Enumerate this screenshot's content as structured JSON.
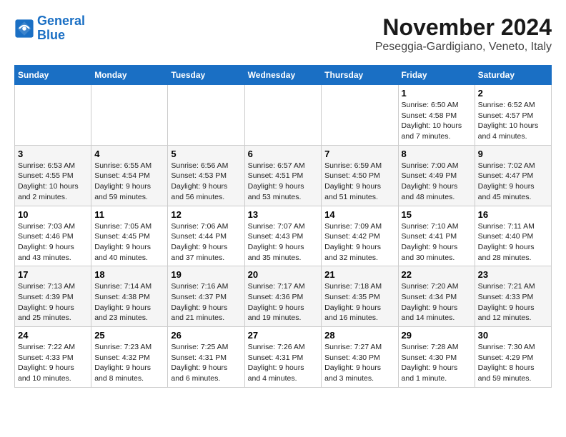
{
  "header": {
    "logo_line1": "General",
    "logo_line2": "Blue",
    "month_title": "November 2024",
    "subtitle": "Peseggia-Gardigiano, Veneto, Italy"
  },
  "weekdays": [
    "Sunday",
    "Monday",
    "Tuesday",
    "Wednesday",
    "Thursday",
    "Friday",
    "Saturday"
  ],
  "weeks": [
    [
      {
        "day": "",
        "info": ""
      },
      {
        "day": "",
        "info": ""
      },
      {
        "day": "",
        "info": ""
      },
      {
        "day": "",
        "info": ""
      },
      {
        "day": "",
        "info": ""
      },
      {
        "day": "1",
        "info": "Sunrise: 6:50 AM\nSunset: 4:58 PM\nDaylight: 10 hours and 7 minutes."
      },
      {
        "day": "2",
        "info": "Sunrise: 6:52 AM\nSunset: 4:57 PM\nDaylight: 10 hours and 4 minutes."
      }
    ],
    [
      {
        "day": "3",
        "info": "Sunrise: 6:53 AM\nSunset: 4:55 PM\nDaylight: 10 hours and 2 minutes."
      },
      {
        "day": "4",
        "info": "Sunrise: 6:55 AM\nSunset: 4:54 PM\nDaylight: 9 hours and 59 minutes."
      },
      {
        "day": "5",
        "info": "Sunrise: 6:56 AM\nSunset: 4:53 PM\nDaylight: 9 hours and 56 minutes."
      },
      {
        "day": "6",
        "info": "Sunrise: 6:57 AM\nSunset: 4:51 PM\nDaylight: 9 hours and 53 minutes."
      },
      {
        "day": "7",
        "info": "Sunrise: 6:59 AM\nSunset: 4:50 PM\nDaylight: 9 hours and 51 minutes."
      },
      {
        "day": "8",
        "info": "Sunrise: 7:00 AM\nSunset: 4:49 PM\nDaylight: 9 hours and 48 minutes."
      },
      {
        "day": "9",
        "info": "Sunrise: 7:02 AM\nSunset: 4:47 PM\nDaylight: 9 hours and 45 minutes."
      }
    ],
    [
      {
        "day": "10",
        "info": "Sunrise: 7:03 AM\nSunset: 4:46 PM\nDaylight: 9 hours and 43 minutes."
      },
      {
        "day": "11",
        "info": "Sunrise: 7:05 AM\nSunset: 4:45 PM\nDaylight: 9 hours and 40 minutes."
      },
      {
        "day": "12",
        "info": "Sunrise: 7:06 AM\nSunset: 4:44 PM\nDaylight: 9 hours and 37 minutes."
      },
      {
        "day": "13",
        "info": "Sunrise: 7:07 AM\nSunset: 4:43 PM\nDaylight: 9 hours and 35 minutes."
      },
      {
        "day": "14",
        "info": "Sunrise: 7:09 AM\nSunset: 4:42 PM\nDaylight: 9 hours and 32 minutes."
      },
      {
        "day": "15",
        "info": "Sunrise: 7:10 AM\nSunset: 4:41 PM\nDaylight: 9 hours and 30 minutes."
      },
      {
        "day": "16",
        "info": "Sunrise: 7:11 AM\nSunset: 4:40 PM\nDaylight: 9 hours and 28 minutes."
      }
    ],
    [
      {
        "day": "17",
        "info": "Sunrise: 7:13 AM\nSunset: 4:39 PM\nDaylight: 9 hours and 25 minutes."
      },
      {
        "day": "18",
        "info": "Sunrise: 7:14 AM\nSunset: 4:38 PM\nDaylight: 9 hours and 23 minutes."
      },
      {
        "day": "19",
        "info": "Sunrise: 7:16 AM\nSunset: 4:37 PM\nDaylight: 9 hours and 21 minutes."
      },
      {
        "day": "20",
        "info": "Sunrise: 7:17 AM\nSunset: 4:36 PM\nDaylight: 9 hours and 19 minutes."
      },
      {
        "day": "21",
        "info": "Sunrise: 7:18 AM\nSunset: 4:35 PM\nDaylight: 9 hours and 16 minutes."
      },
      {
        "day": "22",
        "info": "Sunrise: 7:20 AM\nSunset: 4:34 PM\nDaylight: 9 hours and 14 minutes."
      },
      {
        "day": "23",
        "info": "Sunrise: 7:21 AM\nSunset: 4:33 PM\nDaylight: 9 hours and 12 minutes."
      }
    ],
    [
      {
        "day": "24",
        "info": "Sunrise: 7:22 AM\nSunset: 4:33 PM\nDaylight: 9 hours and 10 minutes."
      },
      {
        "day": "25",
        "info": "Sunrise: 7:23 AM\nSunset: 4:32 PM\nDaylight: 9 hours and 8 minutes."
      },
      {
        "day": "26",
        "info": "Sunrise: 7:25 AM\nSunset: 4:31 PM\nDaylight: 9 hours and 6 minutes."
      },
      {
        "day": "27",
        "info": "Sunrise: 7:26 AM\nSunset: 4:31 PM\nDaylight: 9 hours and 4 minutes."
      },
      {
        "day": "28",
        "info": "Sunrise: 7:27 AM\nSunset: 4:30 PM\nDaylight: 9 hours and 3 minutes."
      },
      {
        "day": "29",
        "info": "Sunrise: 7:28 AM\nSunset: 4:30 PM\nDaylight: 9 hours and 1 minute."
      },
      {
        "day": "30",
        "info": "Sunrise: 7:30 AM\nSunset: 4:29 PM\nDaylight: 8 hours and 59 minutes."
      }
    ]
  ]
}
